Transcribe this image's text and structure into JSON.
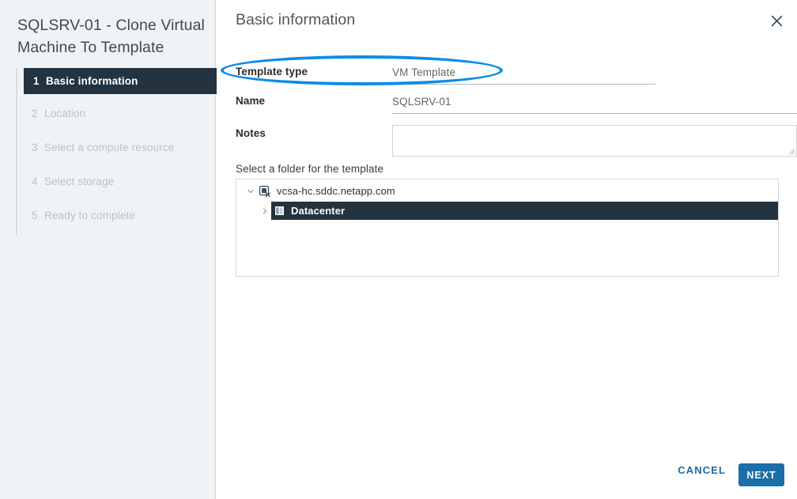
{
  "wizard": {
    "title": "SQLSRV-01 - Clone Virtual Machine To Template",
    "steps": [
      {
        "num": "1",
        "label": "Basic information",
        "state": "active"
      },
      {
        "num": "2",
        "label": "Location",
        "state": "pending"
      },
      {
        "num": "3",
        "label": "Select a compute resource",
        "state": "pending"
      },
      {
        "num": "4",
        "label": "Select storage",
        "state": "pending"
      },
      {
        "num": "5",
        "label": "Ready to complete",
        "state": "pending"
      }
    ]
  },
  "panel": {
    "title": "Basic information",
    "close_icon": "close-icon"
  },
  "form": {
    "template_type": {
      "label": "Template type",
      "value": "VM Template"
    },
    "name": {
      "label": "Name",
      "value": "SQLSRV-01"
    },
    "notes": {
      "label": "Notes",
      "value": "",
      "placeholder": ""
    }
  },
  "tree": {
    "caption": "Select a folder for the template",
    "nodes": [
      {
        "label": "vcsa-hc.sddc.netapp.com",
        "icon": "vcenter-icon",
        "caret": "chevron-down-icon",
        "expanded": true,
        "selected": false
      },
      {
        "label": "Datacenter",
        "icon": "datacenter-icon",
        "caret": "chevron-right-icon",
        "expanded": false,
        "selected": true
      }
    ]
  },
  "footer": {
    "cancel_label": "CANCEL",
    "next_label": "NEXT"
  },
  "annotation": {
    "shape": "ellipse-highlight",
    "target": "Template type",
    "color": "#0c8ce9"
  },
  "colors": {
    "sidebar_bg": "#eff3f6",
    "active_step_bg": "#23333f",
    "accent": "#1b6ea8",
    "annotation": "#0c8ce9",
    "selection_bg": "#23333f"
  }
}
